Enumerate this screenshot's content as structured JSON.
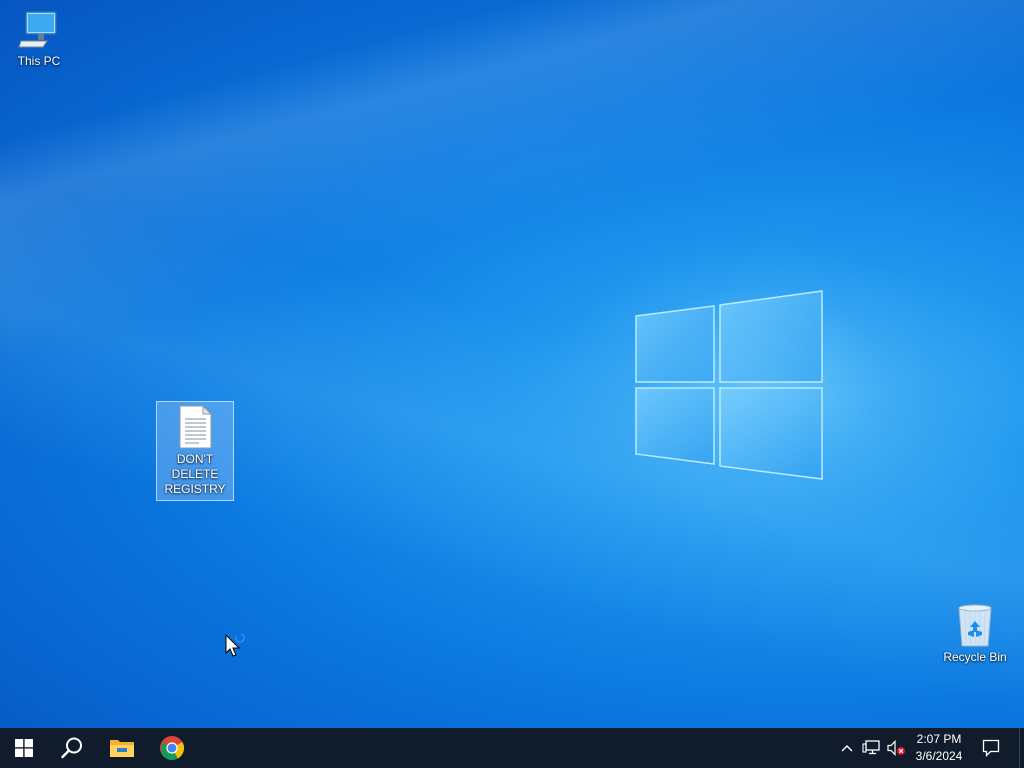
{
  "desktop": {
    "icons": [
      {
        "label": "This PC",
        "icon": "computer-icon"
      },
      {
        "label": "DON'T DELETE REGISTRY",
        "icon": "text-document-icon",
        "selected": true
      },
      {
        "label": "Recycle Bin",
        "icon": "recycle-bin-icon"
      }
    ],
    "wallpaper": "windows-10-hero",
    "colors": {
      "accent": "#0b78e0",
      "taskbar": "#101c2b"
    }
  },
  "taskbar": {
    "pinned": [
      {
        "name": "Start",
        "icon": "windows-icon"
      },
      {
        "name": "Search",
        "icon": "search-icon"
      },
      {
        "name": "File Explorer",
        "icon": "folder-icon"
      },
      {
        "name": "Google Chrome",
        "icon": "chrome-icon"
      }
    ],
    "tray": {
      "icons": [
        "chevron-up-icon",
        "network-icon",
        "volume-muted-icon"
      ],
      "time": "2:07 PM",
      "date": "3/6/2024"
    }
  }
}
